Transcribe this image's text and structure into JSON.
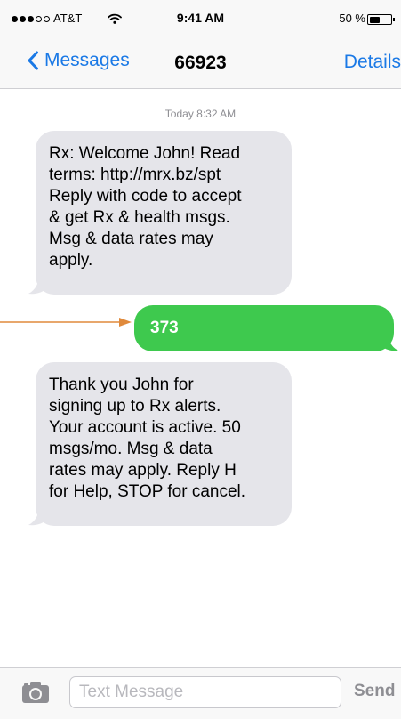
{
  "status_bar": {
    "carrier": "AT&T",
    "time": "9:41 AM",
    "battery_percent": "50 %",
    "signal_bars_filled": 3,
    "signal_bars_total": 5,
    "battery_level": 0.5
  },
  "nav": {
    "back_label": "Messages",
    "title": "66923",
    "details_label": "Details"
  },
  "conversation": {
    "timestamp": "Today 8:32 AM",
    "messages": [
      {
        "direction": "received",
        "lines": [
          "Rx: Welcome John! Read",
          "terms: http://mrx.bz/spt",
          "Reply with code to accept",
          "& get Rx & health msgs.",
          "Msg & data rates may",
          "apply."
        ]
      },
      {
        "direction": "sent",
        "text": "373"
      },
      {
        "direction": "received",
        "lines": [
          "Thank you John for",
          "signing up to Rx alerts.",
          "Your account is active. 50",
          "msgs/mo. Msg & data",
          "rates may apply. Reply H",
          "for Help, STOP for cancel."
        ]
      }
    ]
  },
  "composer": {
    "placeholder": "Text Message",
    "value": "",
    "send_label": "Send"
  },
  "colors": {
    "accent": "#1a79e6",
    "sent_bubble": "#3ec94e",
    "received_bubble": "#e5e5ea",
    "annotation_arrow": "#e08a3c"
  },
  "icons": [
    "wifi-icon",
    "battery-icon",
    "chevron-left-icon",
    "camera-icon",
    "arrow-icon"
  ]
}
